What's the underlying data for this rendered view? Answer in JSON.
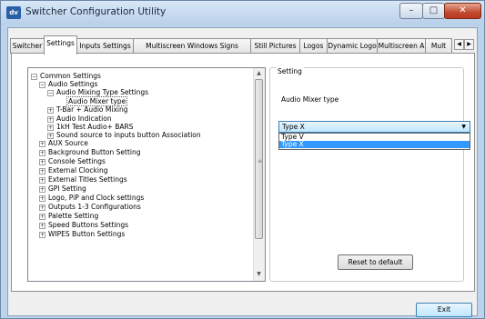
{
  "window": {
    "app_icon": "dv",
    "title": "Switcher Configuration Utility",
    "minimize_icon": "minimize-icon",
    "maximize_icon": "maximize-icon",
    "close_icon": "close-icon"
  },
  "tabs": [
    {
      "label": "Switcher"
    },
    {
      "label": "Settings",
      "active": true
    },
    {
      "label": "Inputs Settings"
    },
    {
      "label": "Multiscreen Windows Signs"
    },
    {
      "label": "Still Pictures"
    },
    {
      "label": "Logos"
    },
    {
      "label": "Dynamic Logo"
    },
    {
      "label": "Multiscreen A"
    },
    {
      "label": "Mult"
    }
  ],
  "tree": {
    "items": [
      {
        "label": "Common Settings",
        "level": 0,
        "toggle": "−"
      },
      {
        "label": "Audio Settings",
        "level": 1,
        "toggle": "−"
      },
      {
        "label": "Audio Mixing Type  Settings",
        "level": 2,
        "toggle": "−"
      },
      {
        "label": "Audio Mixer type",
        "level": 3,
        "toggle": "",
        "selected": true
      },
      {
        "label": "T-Bar + Audio Mixing",
        "level": 2,
        "toggle": "+"
      },
      {
        "label": "Audio Indication",
        "level": 2,
        "toggle": "+"
      },
      {
        "label": "1kH Test Audio+ BARS",
        "level": 2,
        "toggle": "+"
      },
      {
        "label": "Sound source to inputs button Association",
        "level": 2,
        "toggle": "+"
      },
      {
        "label": "AUX Source",
        "level": 1,
        "toggle": "+"
      },
      {
        "label": "Background  Button Setting",
        "level": 1,
        "toggle": "+"
      },
      {
        "label": "Console Settings",
        "level": 1,
        "toggle": "+"
      },
      {
        "label": "External Clocking",
        "level": 1,
        "toggle": "+"
      },
      {
        "label": "External Titles Settings",
        "level": 1,
        "toggle": "+"
      },
      {
        "label": "GPI Setting",
        "level": 1,
        "toggle": "+"
      },
      {
        "label": "Logo, PiP and Clock settings",
        "level": 1,
        "toggle": "+"
      },
      {
        "label": "Outputs 1-3 Configurations",
        "level": 1,
        "toggle": "+"
      },
      {
        "label": "Palette Setting",
        "level": 1,
        "toggle": "+"
      },
      {
        "label": "Speed Buttons Settings",
        "level": 1,
        "toggle": "+"
      },
      {
        "label": "WIPES Button  Settings",
        "level": 1,
        "toggle": "+"
      }
    ]
  },
  "setting": {
    "legend": "Setting",
    "label": "Audio Mixer type",
    "combo_value": "Type X",
    "options": [
      "Type V",
      "Type X"
    ],
    "highlighted_option": "Type X",
    "reset_label": "Reset to default"
  },
  "footer": {
    "exit_label": "Exit"
  }
}
